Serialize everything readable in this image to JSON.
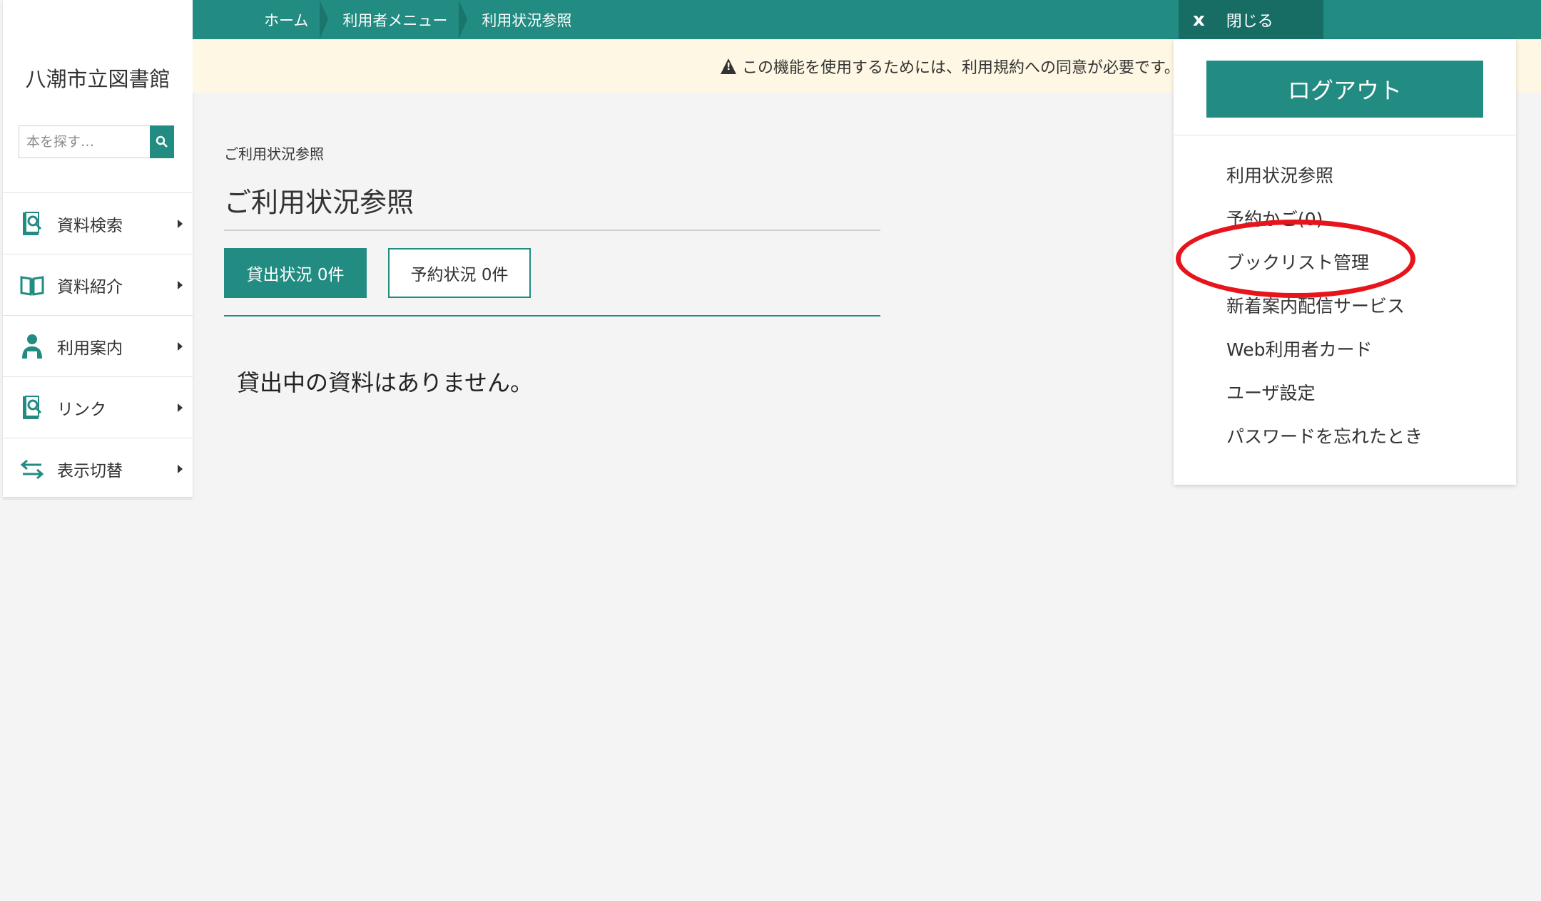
{
  "library": {
    "name": "八潮市立図書館"
  },
  "search": {
    "placeholder": "本を探す…"
  },
  "breadcrumb": [
    "ホーム",
    "利用者メニュー",
    "利用状況参照"
  ],
  "close": {
    "icon": "x",
    "label": "閉じる"
  },
  "notice": {
    "text": "この機能を使用するためには、利用規約への同意が必要です。"
  },
  "sidebar": {
    "items": [
      {
        "label": "資料検索",
        "icon": "search-book-icon"
      },
      {
        "label": "資料紹介",
        "icon": "open-book-icon"
      },
      {
        "label": "利用案内",
        "icon": "user-guide-icon"
      },
      {
        "label": "リンク",
        "icon": "link-book-icon"
      },
      {
        "label": "表示切替",
        "icon": "switch-arrows-icon"
      }
    ]
  },
  "content": {
    "small_title": "ご利用状況参照",
    "title": "ご利用状況参照",
    "tabs": [
      {
        "label": "貸出状況 0件",
        "active": true
      },
      {
        "label": "予約状況 0件",
        "active": false
      }
    ],
    "empty_message": "貸出中の資料はありません。"
  },
  "user_panel": {
    "logout_label": "ログアウト",
    "menu": [
      "利用状況参照",
      "予約かご(0)",
      "ブックリスト管理",
      "新着案内配信サービス",
      "Web利用者カード",
      "ユーザ設定",
      "パスワードを忘れたとき"
    ]
  },
  "colors": {
    "primary": "#228b82",
    "notice_bg": "#fdf7e3",
    "highlight": "#e8141c"
  }
}
